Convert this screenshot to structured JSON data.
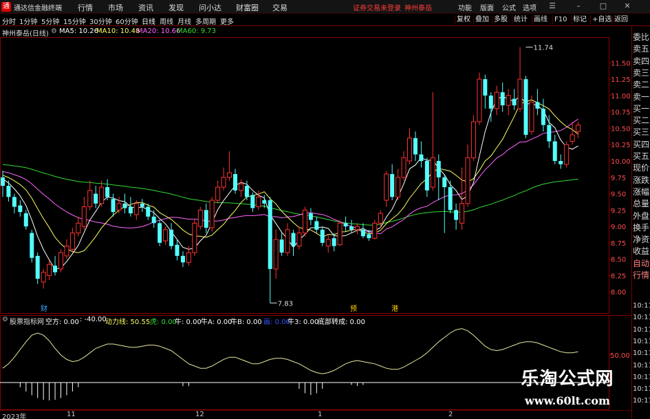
{
  "menubar": {
    "app_title": "通达信金融终端",
    "items": [
      "行情",
      "市场",
      "资讯",
      "发现",
      "问小达",
      "财富圈",
      "交易"
    ],
    "warning": "证券交易未登录",
    "stock_name": "神州泰岳",
    "right_items": [
      "功能",
      "版面",
      "公式",
      "选项"
    ]
  },
  "toolbar": {
    "periods": [
      "分时",
      "1分钟",
      "5分钟",
      "15分钟",
      "30分钟",
      "60分钟",
      "日线",
      "周线",
      "月线",
      "多周期",
      "更多"
    ],
    "active_period": "日线",
    "right_buttons": [
      "复权",
      "叠加",
      "多股",
      "统计",
      "画线",
      "F10",
      "标记",
      "+自选",
      "返回"
    ]
  },
  "legend": {
    "title": "神州泰岳(日线)",
    "ma5": "MA5: 10.26",
    "ma10": "MA10: 10.48",
    "ma20": "MA20: 10.66",
    "ma60": "MA60: 9.73"
  },
  "colors": {
    "up": "#ff3232",
    "down": "#54ffff",
    "ma5": "#ffffff",
    "ma10": "#ffff66",
    "ma20": "#ff66ff",
    "ma60": "#33dd33",
    "grid": "#8b0000"
  },
  "price_axis": {
    "ticks": [
      "11.50",
      "11.25",
      "11.00",
      "10.75",
      "10.50",
      "10.25",
      "10.00",
      "9.75",
      "9.50",
      "9.25",
      "9.00",
      "8.75",
      "8.50",
      "8.25",
      "8.00"
    ]
  },
  "annotations": {
    "high": "11.74",
    "low": "7.83",
    "markers": [
      "财",
      "预",
      "港"
    ]
  },
  "right_panel": {
    "items": [
      "委比",
      "卖五",
      "卖四",
      "卖三",
      "卖二",
      "卖一",
      "买一",
      "买二",
      "买三",
      "买四",
      "买五",
      "现价",
      "涨跌",
      "涨幅",
      "总量",
      "外盘",
      "换手",
      "净资",
      "收益",
      "自动",
      "行情",
      "10:11",
      "10:11",
      "10:11",
      "10:11",
      "10:11",
      "10:11",
      "10:11",
      "10:11",
      "10:11"
    ]
  },
  "indicator": {
    "name": "股票指标网",
    "kong": "空方: 0.00",
    "neg": ": -40.00",
    "dongli": "动力线: 50.55",
    "hu": "虎: 0.00",
    "niu": "牛: 0.00",
    "niuA": "牛A: 0.00",
    "niuB": "牛B: 0.00",
    "gao": "画: 0.00",
    "niu3": "牛3: 0.00",
    "dibu": "底部转成: 0.00",
    "axis_label": "50.00"
  },
  "date_axis": [
    "2023年",
    "11",
    "12",
    "1",
    "2"
  ],
  "watermark": {
    "line1": "乐淘公式网",
    "line2": "www.60lt.com"
  }
}
